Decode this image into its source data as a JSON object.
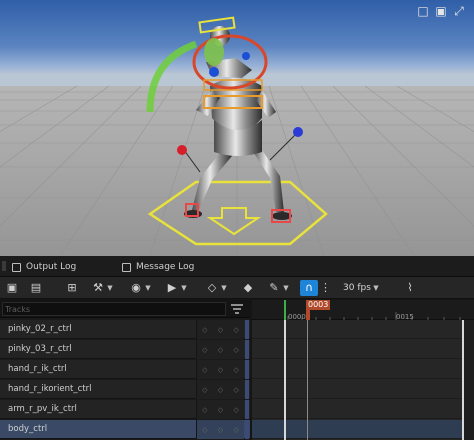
{
  "tabs": [
    {
      "label": "Output Log"
    },
    {
      "label": "Message Log"
    }
  ],
  "toolbar": {
    "fps_label": "30 fps"
  },
  "tracks": {
    "search_placeholder": "Tracks",
    "items": [
      {
        "name": "pinky_02_r_ctrl",
        "selected": false
      },
      {
        "name": "pinky_03_r_ctrl",
        "selected": false
      },
      {
        "name": "hand_r_ik_ctrl",
        "selected": false
      },
      {
        "name": "hand_r_ikorient_ctrl",
        "selected": false
      },
      {
        "name": "arm_r_pv_ik_ctrl",
        "selected": false
      },
      {
        "name": "body_ctrl",
        "selected": true
      }
    ]
  },
  "timeline": {
    "current_frame": "0003",
    "start_frame": "0000",
    "mark_frame": "0015"
  },
  "colors": {
    "sky_top": "#2f5fa8",
    "floor": "#a3a3a3",
    "selected_row": "#3a4a66",
    "accent_blue": "#1e84d8",
    "playhead": "#b04a2a",
    "gizmo_yellow": "#e8e23a"
  }
}
